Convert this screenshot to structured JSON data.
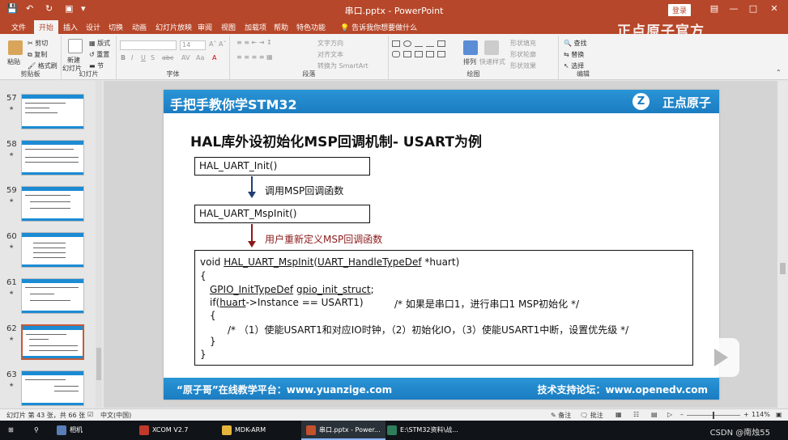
{
  "titlebar": {
    "doc_title": "串口.pptx - PowerPoint",
    "login": "登录"
  },
  "tabs": [
    "文件",
    "开始",
    "插入",
    "设计",
    "切换",
    "动画",
    "幻灯片放映",
    "审阅",
    "视图",
    "加载项",
    "帮助",
    "特色功能"
  ],
  "tab_search": "告诉我你想要做什么",
  "watermark": "正点原子官方",
  "ribbon": {
    "clipboard": {
      "label": "剪贴板",
      "paste": "粘贴",
      "cut": "剪切",
      "copy": "复制",
      "format_painter": "格式刷"
    },
    "slides": {
      "label": "幻灯片",
      "new_slide": "新建",
      "new_slide2": "幻灯片",
      "layout": "版式",
      "reset": "重置",
      "section": "节"
    },
    "font": {
      "label": "字体",
      "size": "14"
    },
    "paragraph": {
      "label": "段落",
      "text_direction": "文字方向",
      "align_text": "对齐文本",
      "smartart": "转换为 SmartArt"
    },
    "drawing": {
      "label": "绘图",
      "arrange": "排列",
      "quick_styles": "快速样式",
      "shape_fill": "形状填充",
      "shape_outline": "形状轮廓",
      "shape_effects": "形状效果"
    },
    "editing": {
      "label": "编辑",
      "find": "查找",
      "replace": "替换",
      "select": "选择"
    }
  },
  "thumbnails": [
    {
      "num": "57"
    },
    {
      "num": "58"
    },
    {
      "num": "59"
    },
    {
      "num": "60"
    },
    {
      "num": "61"
    },
    {
      "num": "62"
    },
    {
      "num": "63"
    }
  ],
  "slide": {
    "header_title": "手把手教你学STM32",
    "brand": "正点原子",
    "heading": "HAL库外设初始化MSP回调机制- USART为例",
    "box1": "HAL_UART_Init()",
    "arrow1_label": "调用MSP回调函数",
    "box2": "HAL_UART_MspInit()",
    "arrow2_label": "用户重新定义MSP回调函数",
    "code": {
      "line1_pre": "void ",
      "line1_fn": "HAL_UART_MspInit",
      "line1_mid": "(",
      "line1_type": "UART_HandleTypeDef",
      "line1_post": " *huart)",
      "line2": "{",
      "line3_type": "GPIO_InitTypeDef",
      "line3_sp": " ",
      "line3_var": "gpio_init_struct",
      "line3_end": ";",
      "line4_pre": "if(",
      "line4_var": "huart",
      "line4_post": "->Instance == USART1)",
      "line4_comment": "/* 如果是串口1，进行串口1 MSP初始化 */",
      "line5": "{",
      "line6": "/* （1）使能USART1和对应IO时钟，（2）初始化IO，（3）使能USART1中断，设置优先级 */",
      "line7": "}",
      "line8": "}"
    },
    "footer_left": "“原子哥”在线教学平台：www.yuanzige.com",
    "footer_right": "技术支持论坛：www.openedv.com"
  },
  "statusbar": {
    "slide_info": "幻灯片 第 43 张，共 66 张",
    "language": "中文(中国)",
    "notes": "备注",
    "comments": "批注",
    "zoom": "114%",
    "zoom_level": 0.5
  },
  "taskbar": {
    "items": [
      "相机",
      "XCOM V2.7",
      "MDK-ARM",
      "串口.pptx - Power...",
      "E:\\STM32资料\\战..."
    ],
    "corner": "CSDN @南烛55"
  },
  "colors": {
    "accent": "#b7472a",
    "slide_blue": "#1b7cc1",
    "arrow_red": "#8b1a1a",
    "arrow_blue": "#1f3f73"
  }
}
